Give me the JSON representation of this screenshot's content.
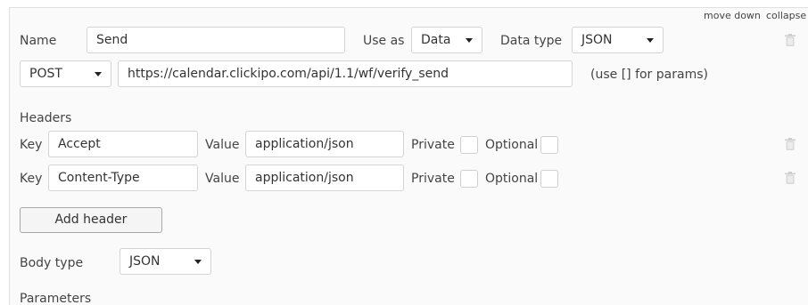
{
  "header": {
    "move_down": "move down",
    "collapse": "collapse"
  },
  "call": {
    "name_label": "Name",
    "name_value": "Send",
    "use_as_label": "Use as",
    "use_as_value": "Data",
    "data_type_label": "Data type",
    "data_type_value": "JSON",
    "method_value": "POST",
    "url_value": "https://calendar.clickipo.com/api/1.1/wf/verify_send",
    "params_hint": "(use [] for params)"
  },
  "headers_section": {
    "title": "Headers",
    "rows": [
      {
        "key_label": "Key",
        "key_value": "Accept",
        "value_label": "Value",
        "value_value": "application/json",
        "private_label": "Private",
        "optional_label": "Optional"
      },
      {
        "key_label": "Key",
        "key_value": "Content-Type",
        "value_label": "Value",
        "value_value": "application/json",
        "private_label": "Private",
        "optional_label": "Optional"
      }
    ],
    "add_header_label": "Add header"
  },
  "body": {
    "body_type_label": "Body type",
    "body_type_value": "JSON",
    "parameters_title": "Parameters"
  },
  "icons": {
    "trash": "trash-icon",
    "dropdown": "chevron-down-icon"
  }
}
